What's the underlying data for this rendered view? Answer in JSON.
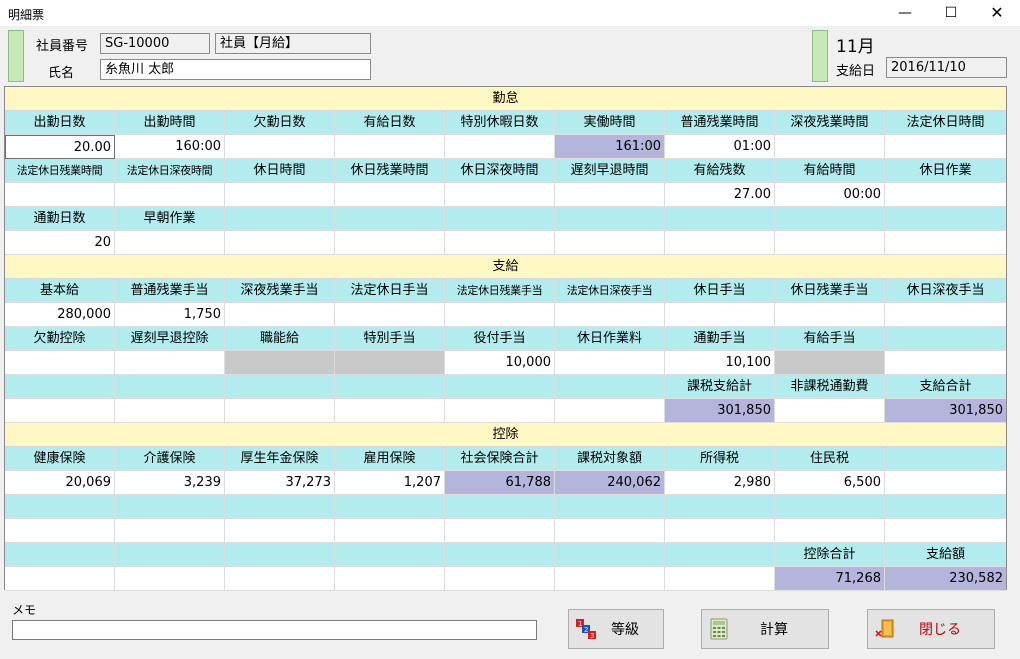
{
  "window": {
    "title": "明細票",
    "minimize": "—",
    "maximize": "☐",
    "close": "✕"
  },
  "header": {
    "employee_no_label": "社員番号",
    "employee_no": "SG-10000",
    "employee_type": "社員【月給】",
    "name_label": "氏名",
    "name": "糸魚川 太郎",
    "month": "11月",
    "payday_label": "支給日",
    "payday": "2016/11/10"
  },
  "sections": {
    "attendance": "勤怠",
    "payment": "支給",
    "deduction": "控除"
  },
  "rows": [
    {
      "type": "hdr",
      "cells": [
        "出勤日数",
        "出勤時間",
        "欠勤日数",
        "有給日数",
        "特別休暇日数",
        "実働時間",
        "普通残業時間",
        "深夜残業時間",
        "法定休日時間"
      ]
    },
    {
      "type": "val",
      "cells": [
        "20.00",
        "160:00",
        "",
        "",
        "",
        "161:00",
        "01:00",
        "",
        ""
      ]
    },
    {
      "type": "hdr",
      "cells": [
        "法定休日残業時間",
        "法定休日深夜時間",
        "休日時間",
        "休日残業時間",
        "休日深夜時間",
        "遅刻早退時間",
        "有給残数",
        "有給時間",
        "休日作業"
      ]
    },
    {
      "type": "val",
      "cells": [
        "",
        "",
        "",
        "",
        "",
        "",
        "27.00",
        "00:00",
        ""
      ]
    },
    {
      "type": "hdr",
      "cells": [
        "通勤日数",
        "早朝作業",
        "",
        "",
        "",
        "",
        "",
        "",
        ""
      ]
    },
    {
      "type": "val",
      "cells": [
        "20",
        "",
        "",
        "",
        "",
        "",
        "",
        "",
        ""
      ]
    },
    {
      "type": "hdr",
      "cells": [
        "基本給",
        "普通残業手当",
        "深夜残業手当",
        "法定休日手当",
        "法定休日残業手当",
        "法定休日深夜手当",
        "休日手当",
        "休日残業手当",
        "休日深夜手当"
      ]
    },
    {
      "type": "val",
      "cells": [
        "280,000",
        "1,750",
        "",
        "",
        "",
        "",
        "",
        "",
        ""
      ]
    },
    {
      "type": "hdr",
      "cells": [
        "欠勤控除",
        "遅刻早退控除",
        "職能給",
        "特別手当",
        "役付手当",
        "休日作業料",
        "通勤手当",
        "有給手当",
        ""
      ]
    },
    {
      "type": "val",
      "cells": [
        "",
        "",
        "",
        "",
        "10,000",
        "",
        "10,100",
        "",
        ""
      ]
    },
    {
      "type": "hdr",
      "cells": [
        "",
        "",
        "",
        "",
        "",
        "",
        "課税支給計",
        "非課税通勤費",
        "支給合計"
      ]
    },
    {
      "type": "val",
      "cells": [
        "",
        "",
        "",
        "",
        "",
        "",
        "301,850",
        "",
        "301,850"
      ]
    },
    {
      "type": "hdr",
      "cells": [
        "健康保険",
        "介護保険",
        "厚生年金保険",
        "雇用保険",
        "社会保険合計",
        "課税対象額",
        "所得税",
        "住民税",
        ""
      ]
    },
    {
      "type": "val",
      "cells": [
        "20,069",
        "3,239",
        "37,273",
        "1,207",
        "61,788",
        "240,062",
        "2,980",
        "6,500",
        ""
      ]
    },
    {
      "type": "hdr",
      "cells": [
        "",
        "",
        "",
        "",
        "",
        "",
        "",
        "",
        ""
      ]
    },
    {
      "type": "val",
      "cells": [
        "",
        "",
        "",
        "",
        "",
        "",
        "",
        "",
        ""
      ]
    },
    {
      "type": "hdr",
      "cells": [
        "",
        "",
        "",
        "",
        "",
        "",
        "",
        "控除合計",
        "支給額"
      ]
    },
    {
      "type": "val",
      "cells": [
        "",
        "",
        "",
        "",
        "",
        "",
        "",
        "71,268",
        "230,582"
      ]
    }
  ],
  "footer": {
    "memo_label": "メモ",
    "memo_value": "",
    "grade_button": "等級",
    "calc_button": "計算",
    "close_button": "閉じる"
  },
  "colors": {
    "header_cell": "#b2ecee",
    "section": "#fff8c4",
    "highlight": "#b4b4dc",
    "disabled": "#c8c8c8",
    "close_text": "#c00000"
  }
}
